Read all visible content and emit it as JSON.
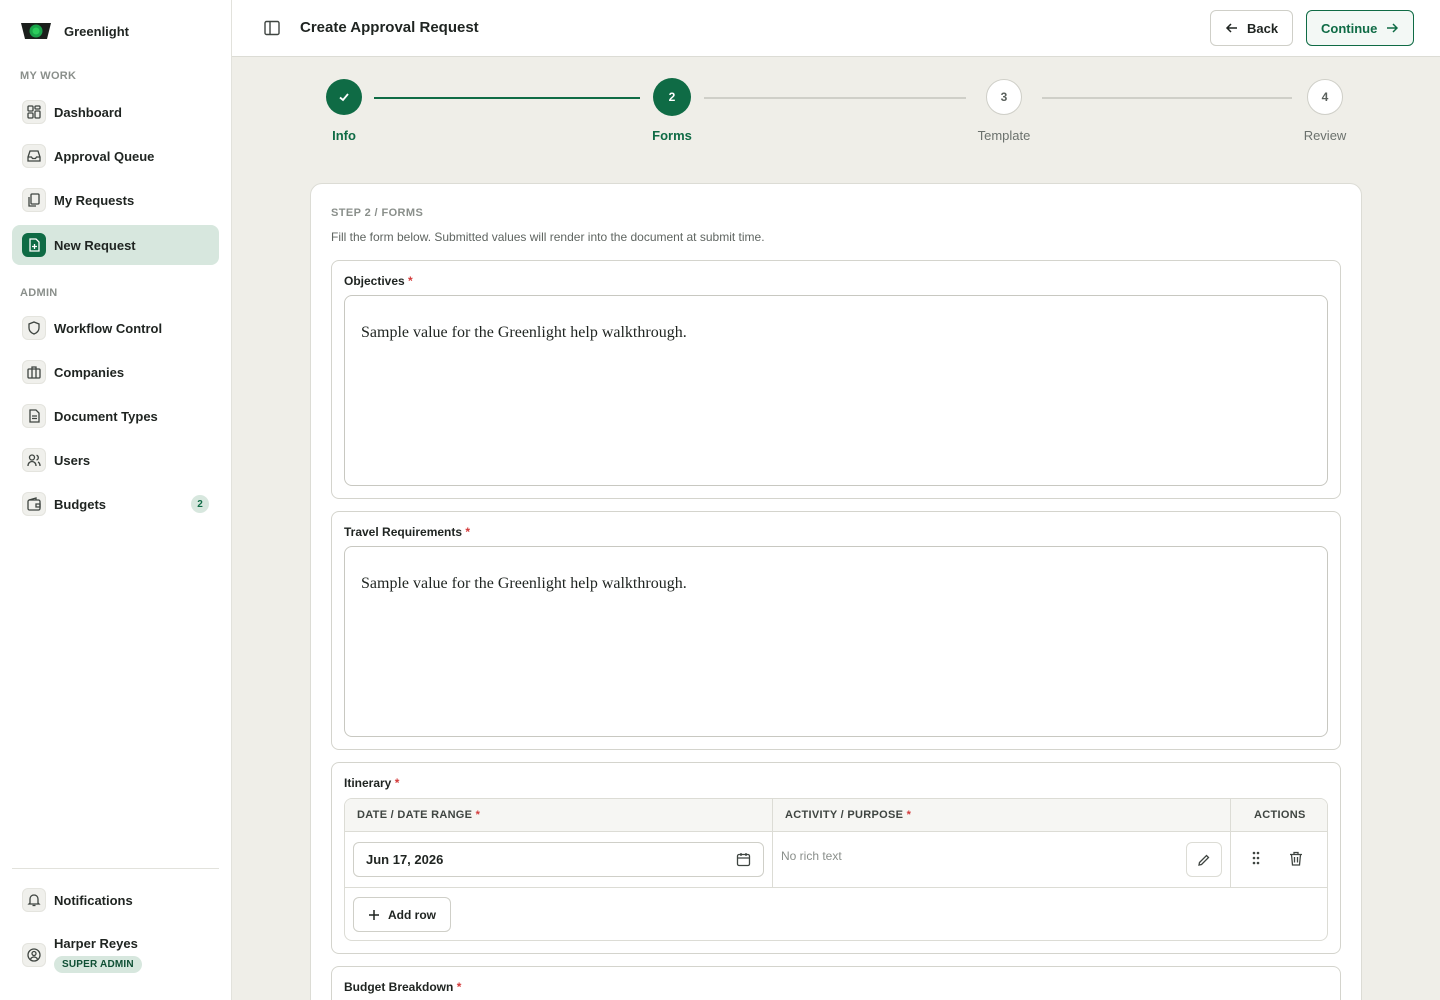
{
  "app": {
    "name": "Greenlight"
  },
  "sidebar": {
    "sections": [
      {
        "label": "MY WORK"
      },
      {
        "label": "ADMIN"
      }
    ],
    "items": [
      {
        "label": "Dashboard",
        "icon": "dashboard-icon"
      },
      {
        "label": "Approval Queue",
        "icon": "inbox-icon"
      },
      {
        "label": "My Requests",
        "icon": "copy-icon"
      },
      {
        "label": "New Request",
        "icon": "file-plus-icon",
        "active": true
      },
      {
        "label": "Workflow Control",
        "icon": "shield-icon"
      },
      {
        "label": "Companies",
        "icon": "briefcase-icon"
      },
      {
        "label": "Document Types",
        "icon": "document-icon"
      },
      {
        "label": "Users",
        "icon": "users-icon"
      },
      {
        "label": "Budgets",
        "icon": "wallet-icon",
        "badge": "2"
      }
    ],
    "notifications_label": "Notifications",
    "user": {
      "name": "Harper Reyes",
      "role": "SUPER ADMIN"
    }
  },
  "header": {
    "title": "Create Approval Request",
    "back_label": "Back",
    "continue_label": "Continue"
  },
  "stepper": {
    "steps": [
      {
        "number": "1",
        "label": "Info",
        "state": "done"
      },
      {
        "number": "2",
        "label": "Forms",
        "state": "current"
      },
      {
        "number": "3",
        "label": "Template",
        "state": "todo"
      },
      {
        "number": "4",
        "label": "Review",
        "state": "todo"
      }
    ]
  },
  "form": {
    "eyebrow": "STEP 2 / FORMS",
    "hint": "Fill the form below. Submitted values will render into the document at submit time.",
    "required_mark": "*",
    "objectives": {
      "label": "Objectives",
      "value": "Sample value for the Greenlight help walkthrough."
    },
    "travel": {
      "label": "Travel Requirements",
      "value": "Sample value for the Greenlight help walkthrough."
    },
    "itinerary": {
      "label": "Itinerary",
      "columns": [
        "DATE / DATE RANGE",
        "ACTIVITY / PURPOSE",
        "ACTIONS"
      ],
      "rows": [
        {
          "date": "Jun 17, 2026",
          "activity_placeholder": "No rich text"
        }
      ],
      "add_row_label": "Add row"
    },
    "budget": {
      "label": "Budget Breakdown"
    }
  },
  "colors": {
    "brand": "#0f6b45",
    "active_nav_bg": "#d7e7de",
    "page_bg": "#efeee8",
    "required": "#d33a3a"
  }
}
